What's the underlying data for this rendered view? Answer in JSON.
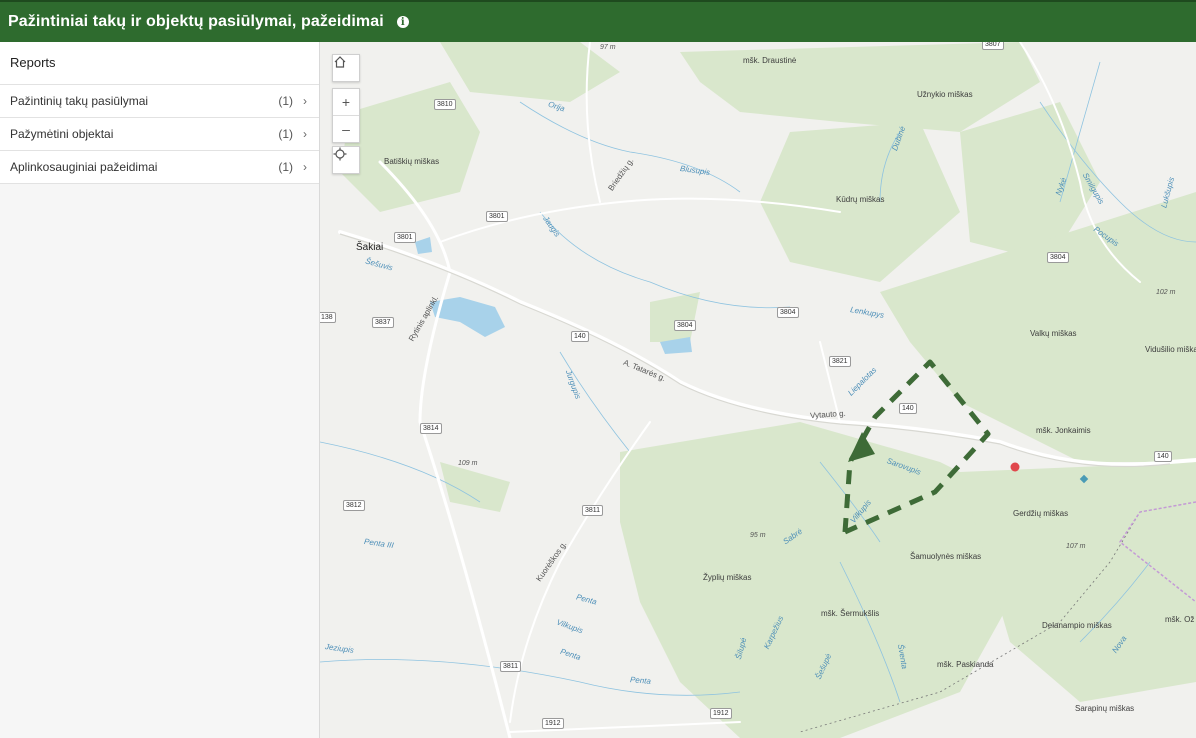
{
  "header": {
    "title": "Pažintiniai takų ir objektų pasiūlymai, pažeidimai",
    "info_glyph": "i"
  },
  "sidebar": {
    "panel_title": "Reports",
    "items": [
      {
        "label": "Pažintinių takų pasiūlymai",
        "count": "(1)"
      },
      {
        "label": "Pažymėtini objektai",
        "count": "(1)"
      },
      {
        "label": "Aplinkosauginiai pažeidimai",
        "count": "(1)"
      }
    ],
    "chevron": "›"
  },
  "map_controls": {
    "home_icon": "home-icon",
    "zoom_in": "+",
    "zoom_out": "–",
    "locate_icon": "locate-icon"
  },
  "colors": {
    "header": "#2e6b2e",
    "forest": "#d9e7cc",
    "water": "#a8d2ea",
    "route": "#3e6b37",
    "point_red": "#e0474c",
    "point_blue": "#4a9bb5"
  },
  "map": {
    "town": "Šakiai",
    "places": [
      "mšk. Draustinė",
      "Užnykio miškas",
      "Batiškių miškas",
      "Kūdrų miškas",
      "Valkų miškas",
      "Vidušilio miškas",
      "mšk. Jonkaimis",
      "Gerdžių miškas",
      "Žyplių miškas",
      "Šamuolynės miškas",
      "mšk. Šermukšlis",
      "Delanampio miškas",
      "mšk. Paskianda",
      "Sarapinų miškas",
      "mšk. Ož"
    ],
    "rivers": [
      "Orija",
      "Blusupis",
      "Jaugis",
      "Šešuvis",
      "Dubinė",
      "Nykė",
      "Smilgupis",
      "Lukšupis",
      "Pocupis",
      "Lenkupys",
      "Jurgupis",
      "Liepalotas",
      "Sarovupis",
      "Sabrė",
      "Vilkupis",
      "Vilkupis",
      "Penta",
      "Penta",
      "Penta",
      "Penta III",
      "Jeziupis",
      "Šilupė",
      "Karpežius",
      "Šešupė",
      "Šventa",
      "Nova"
    ],
    "streets": [
      "Briedžių g.",
      "Rytinis aplinkl.",
      "A. Tatarės g.",
      "Vytauto g.",
      "Kuorėškos g."
    ],
    "elevations": [
      "97 m",
      "102 m",
      "109 m",
      "95 m",
      "107 m"
    ],
    "roads": [
      "3807",
      "3810",
      "3801",
      "3801",
      "3837",
      "138",
      "140",
      "3804",
      "3804",
      "3804",
      "3821",
      "140",
      "140",
      "3814",
      "3812",
      "3811",
      "3811",
      "1912",
      "1912"
    ]
  }
}
